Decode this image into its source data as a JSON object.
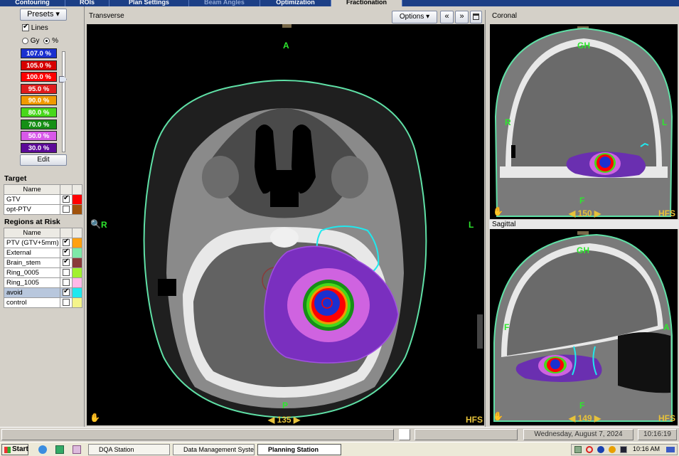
{
  "tabs": [
    {
      "label": "Contouring",
      "state": "normal"
    },
    {
      "label": "ROIs",
      "state": "normal"
    },
    {
      "label": "Plan Settings",
      "state": "normal"
    },
    {
      "label": "Beam Angles",
      "state": "dim"
    },
    {
      "label": "Optimization",
      "state": "normal"
    },
    {
      "label": "Fractionation",
      "state": "active"
    }
  ],
  "left": {
    "presets_label": "Presets ▾",
    "lines_label": "Lines",
    "gy_label": "Gy",
    "pct_label": "%",
    "isodose": [
      {
        "label": "107.0 %",
        "color": "#1a30d0"
      },
      {
        "label": "105.0 %",
        "color": "#d80000"
      },
      {
        "label": "100.0 %",
        "color": "#ff0000"
      },
      {
        "label": "95.0 %",
        "color": "#e01c1c"
      },
      {
        "label": "90.0 %",
        "color": "#f09a00"
      },
      {
        "label": "80.0 %",
        "color": "#48d81a"
      },
      {
        "label": "70.0 %",
        "color": "#168f16"
      },
      {
        "label": "50.0 %",
        "color": "#d859e9"
      },
      {
        "label": "30.0 %",
        "color": "#5c0a98"
      }
    ],
    "edit_label": "Edit",
    "target_title": "Target",
    "name_header": "Name",
    "targets": [
      {
        "name": "GTV",
        "checked": true,
        "color": "#ff0000"
      },
      {
        "name": "opt-PTV",
        "checked": false,
        "color": "#a0520c"
      }
    ],
    "rar_title": "Regions at Risk",
    "regions": [
      {
        "name": "PTV (GTV+5mm)",
        "checked": true,
        "color": "#ffa010",
        "selected": false
      },
      {
        "name": "External",
        "checked": true,
        "color": "#7ee8a8",
        "selected": false
      },
      {
        "name": "Brain_stem",
        "checked": true,
        "color": "#8a3a3a",
        "selected": false
      },
      {
        "name": "Ring_0005",
        "checked": false,
        "color": "#a2f030",
        "selected": false
      },
      {
        "name": "Ring_1005",
        "checked": false,
        "color": "#ffb8e8",
        "selected": false
      },
      {
        "name": "avoid",
        "checked": true,
        "color": "#20e8ee",
        "selected": true
      },
      {
        "name": "control",
        "checked": false,
        "color": "#f4f48a",
        "selected": false
      }
    ]
  },
  "transverse": {
    "title": "Transverse",
    "options_label": "Options ▾",
    "anterior": "A",
    "posterior": "P",
    "right": "R",
    "left": "L",
    "slice": "135",
    "orientation": "HFS"
  },
  "coronal": {
    "title": "Coronal",
    "top": "GH",
    "bottom": "F",
    "right": "R",
    "left": "L",
    "slice": "150",
    "orientation": "HFS"
  },
  "sagittal": {
    "title": "Sagittal",
    "top": "GH",
    "bottom": "F",
    "posterior": "F",
    "anterior": "A",
    "slice": "149",
    "orientation": "HFS"
  },
  "status": {
    "date": "Wednesday, August 7, 2024",
    "time": "10:16:19"
  },
  "taskbar": {
    "start": "Start",
    "items": [
      {
        "label": "DQA Station",
        "active": false
      },
      {
        "label": "Data Management Syste...",
        "active": false
      },
      {
        "label": "Planning Station",
        "active": true
      }
    ],
    "clock": "10:16 AM"
  }
}
